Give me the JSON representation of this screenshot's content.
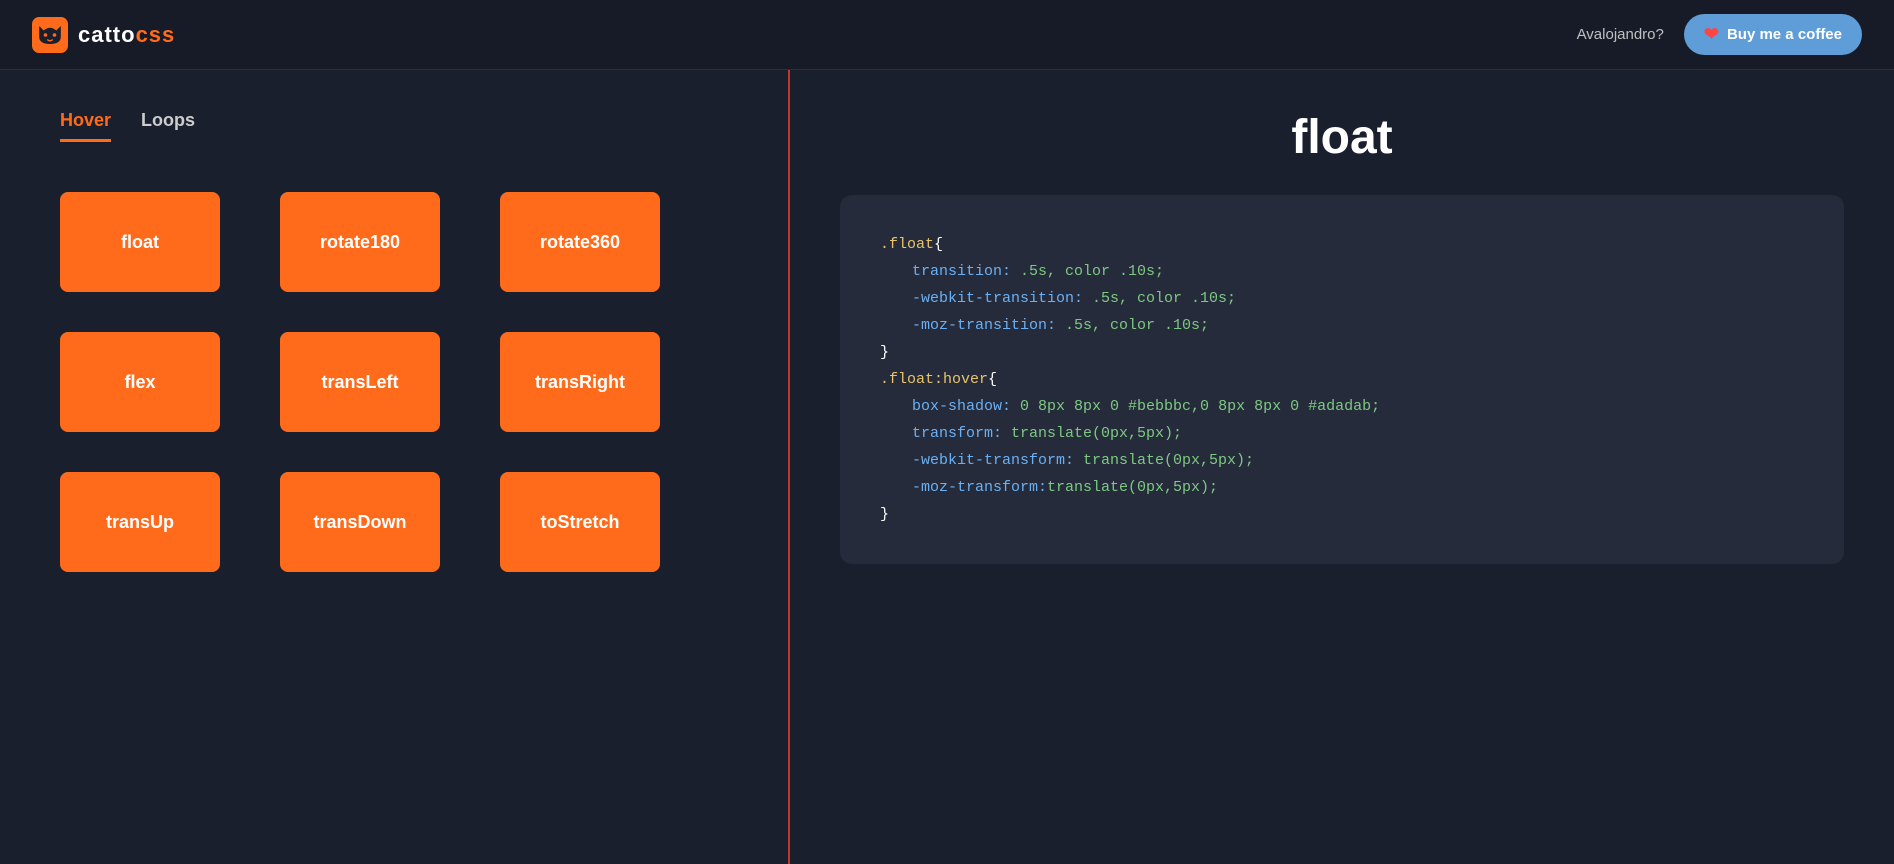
{
  "navbar": {
    "logo_catto": "catto",
    "logo_css": "css",
    "username": "Avalojandro?",
    "buy_coffee_label": "Buy me a coffee"
  },
  "tabs": [
    {
      "id": "hover",
      "label": "Hover",
      "active": true
    },
    {
      "id": "loops",
      "label": "Loops",
      "active": false
    }
  ],
  "animations": [
    {
      "id": "float",
      "label": "float"
    },
    {
      "id": "rotate180",
      "label": "rotate180"
    },
    {
      "id": "rotate360",
      "label": "rotate360"
    },
    {
      "id": "flex",
      "label": "flex"
    },
    {
      "id": "transleft",
      "label": "transLeft"
    },
    {
      "id": "transright",
      "label": "transRight"
    },
    {
      "id": "transup",
      "label": "transUp"
    },
    {
      "id": "transdown",
      "label": "transDown"
    },
    {
      "id": "tostretch",
      "label": "toStretch"
    }
  ],
  "code_panel": {
    "title": "float",
    "lines": [
      {
        "type": "selector",
        "text": ".float{"
      },
      {
        "type": "property-value",
        "property": "transition:",
        "value": " .5s, color .10s;"
      },
      {
        "type": "property-value",
        "property": "-webkit-transition:",
        "value": " .5s, color .10s;"
      },
      {
        "type": "property-value",
        "property": "-moz-transition:",
        "value": " .5s, color .10s;"
      },
      {
        "type": "close",
        "text": "}"
      },
      {
        "type": "selector",
        "text": ".float:hover{"
      },
      {
        "type": "property-value",
        "property": "box-shadow:",
        "value": " 0 8px 8px 0 #bebbbc,0 8px 8px 0 #adadab;"
      },
      {
        "type": "property-value",
        "property": "transform:",
        "value": " translate(0px,5px);"
      },
      {
        "type": "property-value",
        "property": "-webkit-transform:",
        "value": " translate(0px,5px);"
      },
      {
        "type": "property-value",
        "property": "-moz-transform:",
        "value": "translate(0px,5px);"
      },
      {
        "type": "close",
        "text": "}"
      }
    ]
  }
}
